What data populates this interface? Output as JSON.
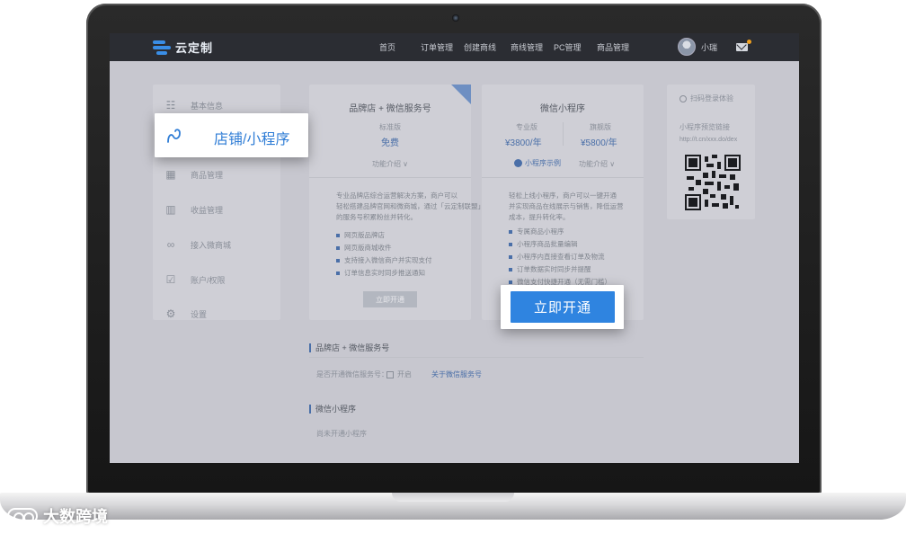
{
  "brand": {
    "name": "云定制"
  },
  "nav": {
    "items": [
      "首页",
      "订单管理",
      "创建商线",
      "商线管理",
      "PC管理",
      "商品管理"
    ],
    "user_name": "小瑞"
  },
  "sidebar": {
    "items": [
      {
        "label": "基本信息",
        "icon": "grid-icon"
      },
      {
        "label": "店铺/小程序",
        "icon": "link-loop-icon"
      },
      {
        "label": "商品管理",
        "icon": "store-icon"
      },
      {
        "label": "收益管理",
        "icon": "bar-chart-icon"
      },
      {
        "label": "接入微商城",
        "icon": "link-icon"
      },
      {
        "label": "账户/权限",
        "icon": "check-square-icon"
      },
      {
        "label": "设置",
        "icon": "gear-icon"
      }
    ]
  },
  "card_brand": {
    "title": "品牌店 + 微信服务号",
    "plan_label": "标准版",
    "price": "免费",
    "features_toggle": "功能介绍 ∨",
    "description": "专业品牌店综合运营解决方案，商户可以\n轻松搭建品牌官网和微商城，通过「云定制联盟」\n的服务号积累粉丝并转化。",
    "features": [
      "网页版品牌店",
      "网页版商城收件",
      "支持接入微信商户并实现支付",
      "订单信息实时同步推送通知"
    ],
    "button_label": "立即开通"
  },
  "card_mini": {
    "title": "微信小程序",
    "plan_a_label": "专业版",
    "plan_a_price": "¥3800/年",
    "plan_b_label": "旗舰版",
    "plan_b_price": "¥5800/年",
    "example_label": "小程序示例",
    "features_toggle": "功能介绍 ∨",
    "description": "轻松上线小程序，商户可以一键开通\n并实现商品在线展示与销售，降低运营\n成本，提升转化率。",
    "features": [
      "专属商品小程序",
      "小程序商品批量编辑",
      "小程序内直接查看订单及物流",
      "订单数据实时同步并提醒",
      "微信支付快捷开通（无需门槛）"
    ],
    "button_label": "立即开通"
  },
  "qr_card": {
    "title": "扫码登录体验",
    "link_label": "小程序预览链接",
    "link_value": "http://t.cn/xxx.do/dex"
  },
  "section_brand": {
    "title": "品牌店 + 微信服务号",
    "question": "是否开通微信服务号：",
    "toggle_label": "开启",
    "link": "关于微信服务号"
  },
  "section_mini": {
    "title": "微信小程序",
    "status": "尚未开通小程序"
  },
  "watermark": {
    "text": "大数跨境"
  },
  "colors": {
    "accent": "#2f84e0",
    "header": "#2b2d33",
    "dim": "#c7c7cf"
  }
}
